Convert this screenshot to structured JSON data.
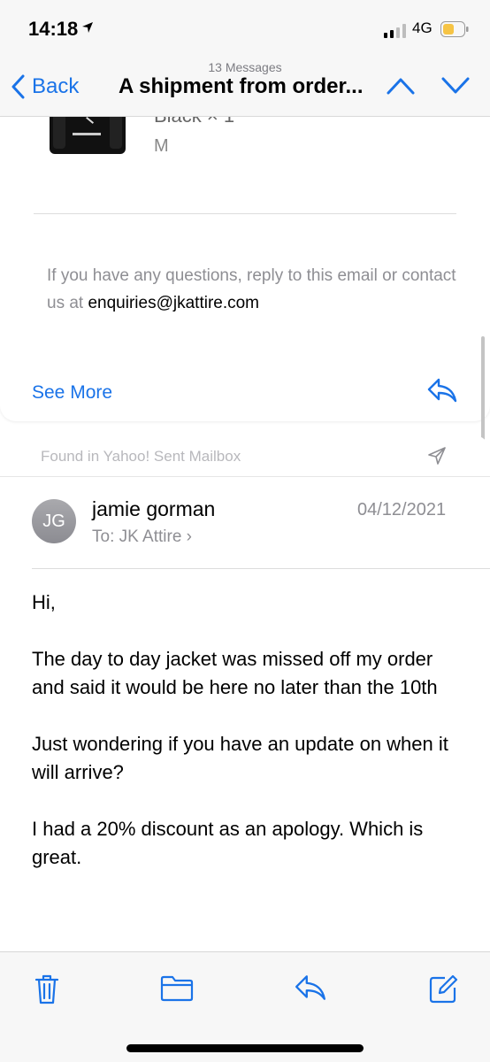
{
  "status_bar": {
    "time": "14:18",
    "network": "4G"
  },
  "nav": {
    "back_label": "Back",
    "message_count": "13 Messages",
    "title": "A shipment from order..."
  },
  "message1": {
    "quantity": "Black × 1",
    "variant": "M",
    "questions_text": "If you have any questions, reply to this email or contact us at",
    "email": "enquiries@jkattire.com",
    "see_more_label": "See More"
  },
  "message2": {
    "found_in": "Found in Yahoo! Sent Mailbox",
    "avatar_initials": "JG",
    "sender": "jamie gorman",
    "to_label": "To:",
    "to_name": "JK Attire",
    "date": "04/12/2021",
    "body": [
      "Hi,",
      "The day to day jacket was missed off my order and said it would be here no later than the 10th",
      "Just wondering if you have an update on when it will arrive?",
      "I had a 20% discount as an apology. Which is great."
    ]
  },
  "colors": {
    "accent": "#1a73e8",
    "secondary_text": "#8e8e93"
  }
}
